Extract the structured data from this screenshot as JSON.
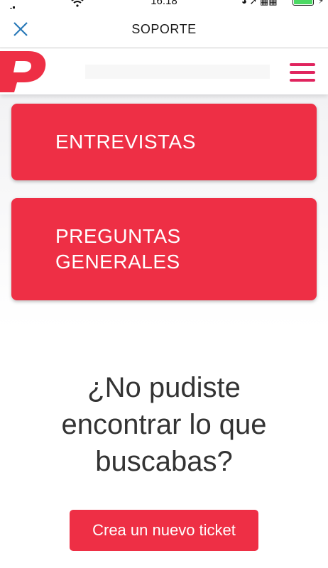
{
  "status_bar": {
    "time": "16:18"
  },
  "nav_bar": {
    "title": "SOPORTE"
  },
  "categories": [
    {
      "lines": [
        "ENTREVISTAS"
      ]
    },
    {
      "lines": [
        "PREGUNTAS",
        "GENERALES"
      ]
    }
  ],
  "help": {
    "headline_lines": [
      "¿No pudiste",
      "encontrar lo que",
      "buscabas?"
    ],
    "button_label": "Crea un nuevo ticket"
  },
  "colors": {
    "accent": "#ee2f45",
    "menu": "#e0245e",
    "close_icon": "#2a7ab8",
    "text": "#333333"
  },
  "icons": {
    "close": "close-icon",
    "logo": "brand-logo",
    "menu": "hamburger-menu-icon"
  }
}
